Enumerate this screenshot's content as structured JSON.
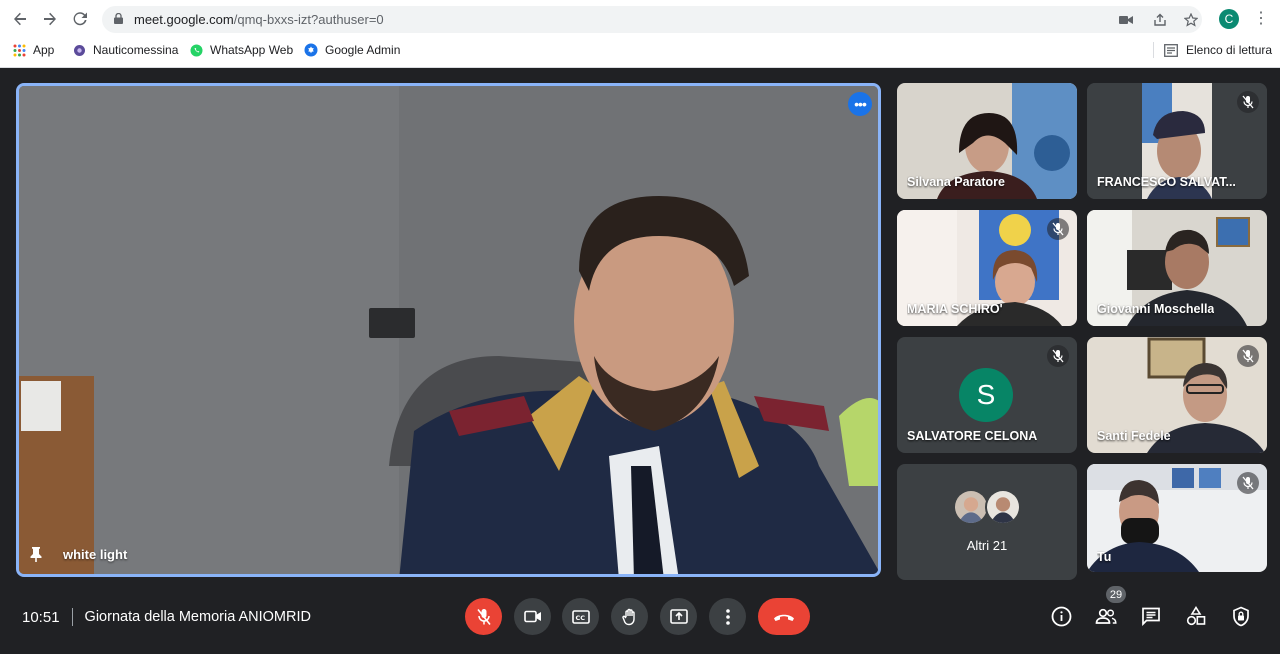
{
  "browser": {
    "url_host": "meet.google.com",
    "url_path": "/qmq-bxxs-izt?authuser=0",
    "profile_initial": "C",
    "bookmarks": [
      {
        "label": "App",
        "icon": "apps-grid-icon"
      },
      {
        "label": "Nauticomessina",
        "icon": "nauticomessina-favicon"
      },
      {
        "label": "WhatsApp Web",
        "icon": "whatsapp-icon"
      },
      {
        "label": "Google Admin",
        "icon": "google-admin-icon"
      }
    ],
    "reading_list": "Elenco di lettura"
  },
  "main_tile": {
    "name": "white light",
    "accent": "#8ab4f8"
  },
  "participants": [
    {
      "name": "Silvana Paratore",
      "muted": false
    },
    {
      "name": "FRANCESCO SALVAT...",
      "muted": true
    },
    {
      "name": "MARIA SCHIRO'",
      "muted": true
    },
    {
      "name": "Giovanni Moschella",
      "muted": false
    },
    {
      "name": "SALVATORE CELONA",
      "muted": true,
      "avatar_letter": "S",
      "avatar_color": "#078566"
    },
    {
      "name": "Santi Fedele",
      "muted": true
    },
    {
      "name": "Tu",
      "muted": true
    }
  ],
  "others": {
    "label": "Altri 21"
  },
  "meeting": {
    "time": "10:51",
    "title": "Giornata della Memoria ANIOMRID",
    "participant_count": "29"
  },
  "colors": {
    "background": "#202124",
    "control": "#3c4043",
    "danger": "#ea4335"
  }
}
